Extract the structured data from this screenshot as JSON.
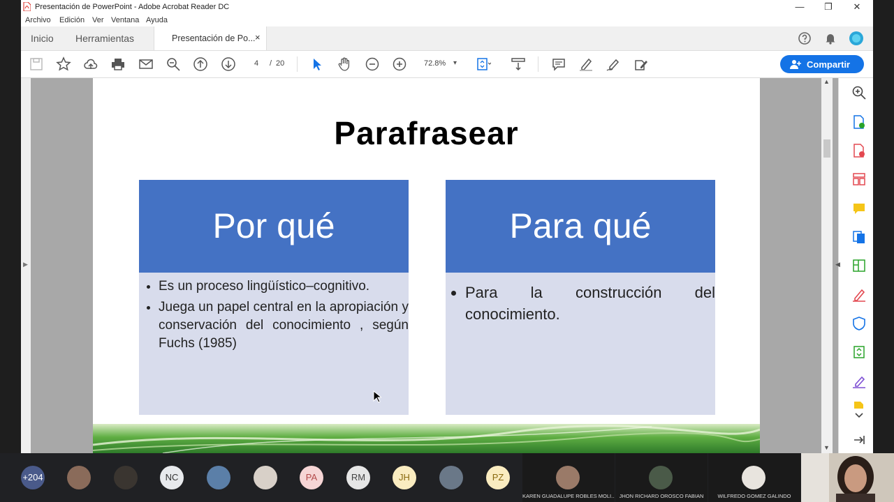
{
  "window": {
    "title": "Presentación de PowerPoint - Adobe Acrobat Reader DC",
    "controls": [
      "—",
      "❐",
      "✕"
    ]
  },
  "menu": [
    "Archivo",
    "Edición",
    "Ver",
    "Ventana",
    "Ayuda"
  ],
  "tabs": {
    "home": "Inicio",
    "tools": "Herramientas",
    "document": "Presentación de Po...",
    "close": "×"
  },
  "toolbar": {
    "page_current": "4",
    "page_sep": "/",
    "page_total": "20",
    "zoom": "72.8%",
    "zoom_caret": "▾",
    "share_label": "Compartir"
  },
  "slide": {
    "title": "Parafrasear",
    "left_card": {
      "heading": "Por qué",
      "bullets": [
        "Es un proceso lingüístico–cognitivo.",
        "Juega un papel central en la apropiación y conservación del conocimiento , según Fuchs (1985)"
      ]
    },
    "right_card": {
      "heading": "Para qué",
      "bullets": [
        "Para la construcción del conocimiento."
      ]
    }
  },
  "meeting": {
    "overflow_count": "+204",
    "initials": [
      "NC",
      "PA",
      "RM",
      "JH",
      "PZ"
    ],
    "participants": [
      "KAREN GUADALUPE ROBLES MOLI...",
      "JHON RICHARD OROSCO FABIAN",
      "WILFREDO GOMEZ GALINDO"
    ]
  },
  "colors": {
    "accent": "#1473e6",
    "slide_header": "#4472c4",
    "slide_body": "#d8dcec"
  }
}
